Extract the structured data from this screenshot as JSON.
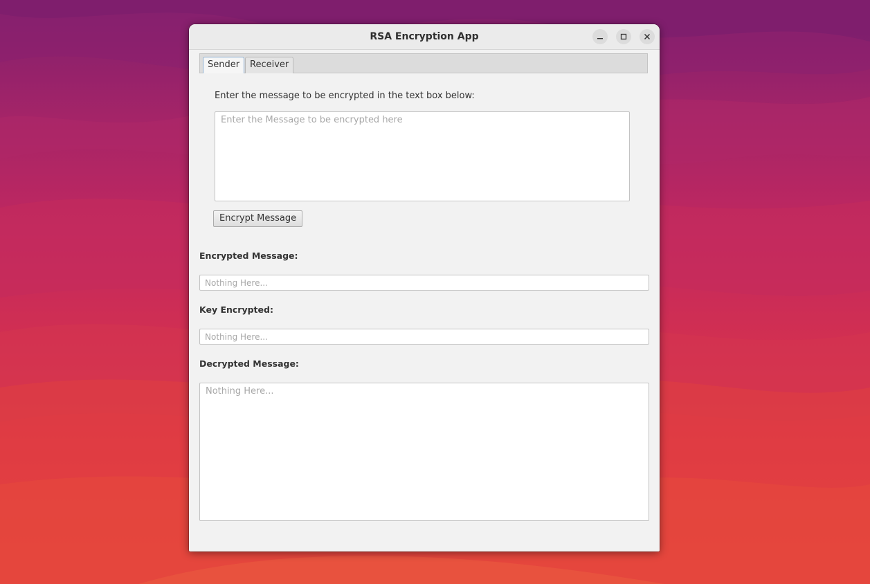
{
  "window": {
    "title": "RSA Encryption App",
    "controls": {
      "minimize": "minimize-icon",
      "maximize": "maximize-icon",
      "close": "close-icon"
    }
  },
  "tabs": [
    {
      "label": "Sender",
      "active": true
    },
    {
      "label": "Receiver",
      "active": false
    }
  ],
  "sender": {
    "instruction": "Enter the message to be encrypted in the text box below:",
    "message_input": {
      "value": "",
      "placeholder": "Enter the Message to be encrypted here"
    },
    "encrypt_button": "Encrypt Message",
    "encrypted_label": "Encrypted Message:",
    "encrypted_field": {
      "value": "",
      "placeholder": "Nothing Here..."
    },
    "key_label": "Key Encrypted:",
    "key_field": {
      "value": "",
      "placeholder": "Nothing Here..."
    },
    "decrypted_label": "Decrypted Message:",
    "decrypted_field": {
      "value": "",
      "placeholder": "Nothing Here..."
    }
  },
  "colors": {
    "window_bg": "#f2f2f2",
    "titlebar_bg": "#ebebeb",
    "tab_active_border": "#8fb0d2",
    "placeholder": "#a8a8a8"
  }
}
